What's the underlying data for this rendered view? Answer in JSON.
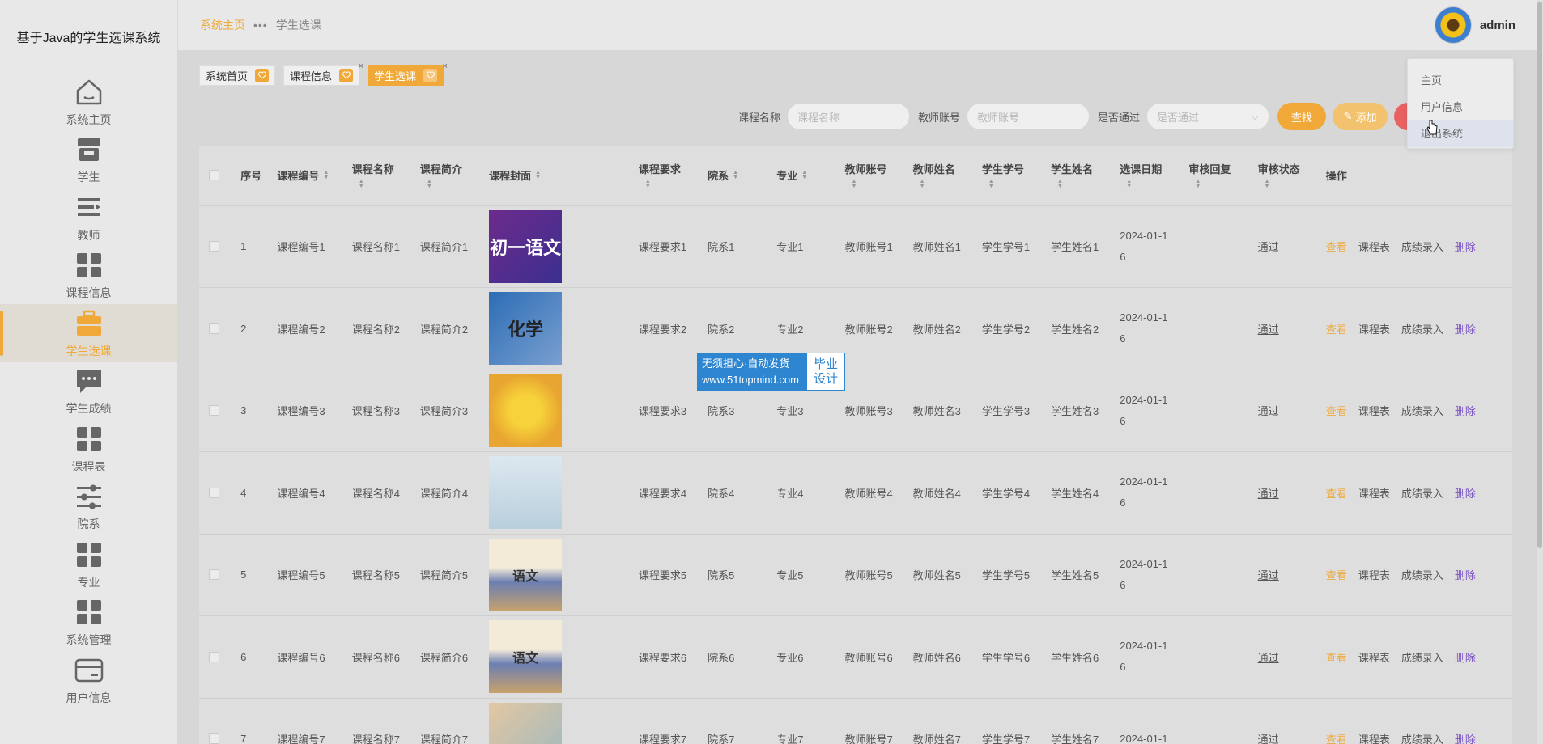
{
  "app": {
    "title": "基于Java的学生选课系统"
  },
  "sidebar": {
    "items": [
      {
        "label": "系统主页",
        "icon": "home-icon"
      },
      {
        "label": "学生",
        "icon": "store-icon"
      },
      {
        "label": "教师",
        "icon": "list-icon"
      },
      {
        "label": "课程信息",
        "icon": "grid-icon"
      },
      {
        "label": "学生选课",
        "icon": "briefcase-icon"
      },
      {
        "label": "学生成绩",
        "icon": "chat-icon"
      },
      {
        "label": "课程表",
        "icon": "grid-icon"
      },
      {
        "label": "院系",
        "icon": "sliders-icon"
      },
      {
        "label": "专业",
        "icon": "grid-icon"
      },
      {
        "label": "系统管理",
        "icon": "grid-icon"
      },
      {
        "label": "用户信息",
        "icon": "card-icon"
      }
    ]
  },
  "header": {
    "breadcrumb_home": "系统主页",
    "breadcrumb_current": "学生选课",
    "username": "admin"
  },
  "dropdown": {
    "items": [
      "主页",
      "用户信息",
      "退出系统"
    ]
  },
  "tabs": [
    {
      "label": "系统首页"
    },
    {
      "label": "课程信息"
    },
    {
      "label": "学生选课"
    }
  ],
  "search": {
    "course_name_label": "课程名称",
    "course_name_placeholder": "课程名称",
    "teacher_label": "教师账号",
    "teacher_placeholder": "教师账号",
    "passed_label": "是否通过",
    "passed_placeholder": "是否通过",
    "search_button": "查找",
    "add_button": "添加"
  },
  "table": {
    "columns": [
      "序号",
      "课程编号",
      "课程名称",
      "课程简介",
      "课程封面",
      "课程要求",
      "院系",
      "专业",
      "教师账号",
      "教师姓名",
      "学生学号",
      "学生姓名",
      "选课日期",
      "审核回复",
      "审核状态",
      "操作"
    ],
    "rows": [
      {
        "no": "1",
        "code": "课程编号1",
        "name": "课程名称1",
        "intro": "课程简介1",
        "req": "课程要求1",
        "dept": "院系1",
        "major": "专业1",
        "tacc": "教师账号1",
        "tname": "教师姓名1",
        "sno": "学生学号1",
        "sname": "学生姓名1",
        "date1": "2024-01-1",
        "date2": "6",
        "status": "通过",
        "cover_text": "初一语文"
      },
      {
        "no": "2",
        "code": "课程编号2",
        "name": "课程名称2",
        "intro": "课程简介2",
        "req": "课程要求2",
        "dept": "院系2",
        "major": "专业2",
        "tacc": "教师账号2",
        "tname": "教师姓名2",
        "sno": "学生学号2",
        "sname": "学生姓名2",
        "date1": "2024-01-1",
        "date2": "6",
        "status": "通过",
        "cover_text": "化学"
      },
      {
        "no": "3",
        "code": "课程编号3",
        "name": "课程名称3",
        "intro": "课程简介3",
        "req": "课程要求3",
        "dept": "院系3",
        "major": "专业3",
        "tacc": "教师账号3",
        "tname": "教师姓名3",
        "sno": "学生学号3",
        "sname": "学生姓名3",
        "date1": "2024-01-1",
        "date2": "6",
        "status": "通过",
        "cover_text": ""
      },
      {
        "no": "4",
        "code": "课程编号4",
        "name": "课程名称4",
        "intro": "课程简介4",
        "req": "课程要求4",
        "dept": "院系4",
        "major": "专业4",
        "tacc": "教师账号4",
        "tname": "教师姓名4",
        "sno": "学生学号4",
        "sname": "学生姓名4",
        "date1": "2024-01-1",
        "date2": "6",
        "status": "通过",
        "cover_text": ""
      },
      {
        "no": "5",
        "code": "课程编号5",
        "name": "课程名称5",
        "intro": "课程简介5",
        "req": "课程要求5",
        "dept": "院系5",
        "major": "专业5",
        "tacc": "教师账号5",
        "tname": "教师姓名5",
        "sno": "学生学号5",
        "sname": "学生姓名5",
        "date1": "2024-01-1",
        "date2": "6",
        "status": "通过",
        "cover_text": "语文"
      },
      {
        "no": "6",
        "code": "课程编号6",
        "name": "课程名称6",
        "intro": "课程简介6",
        "req": "课程要求6",
        "dept": "院系6",
        "major": "专业6",
        "tacc": "教师账号6",
        "tname": "教师姓名6",
        "sno": "学生学号6",
        "sname": "学生姓名6",
        "date1": "2024-01-1",
        "date2": "6",
        "status": "通过",
        "cover_text": "语文"
      },
      {
        "no": "7",
        "code": "课程编号7",
        "name": "课程名称7",
        "intro": "课程简介7",
        "req": "课程要求7",
        "dept": "院系7",
        "major": "专业7",
        "tacc": "教师账号7",
        "tname": "教师姓名7",
        "sno": "学生学号7",
        "sname": "学生姓名7",
        "date1": "2024-01-1",
        "date2": "",
        "status": "通过",
        "cover_text": ""
      }
    ],
    "actions": {
      "view": "查看",
      "schedule": "课程表",
      "grade": "成绩录入",
      "delete": "删除"
    }
  },
  "watermark": {
    "line1": "无须担心·自动发货",
    "line2": "www.51topmind.com",
    "right1": "毕业",
    "right2": "设计"
  },
  "colors": {
    "accent": "#f0a938",
    "delete": "#7c53c5",
    "watermark": "#2e86d1"
  }
}
